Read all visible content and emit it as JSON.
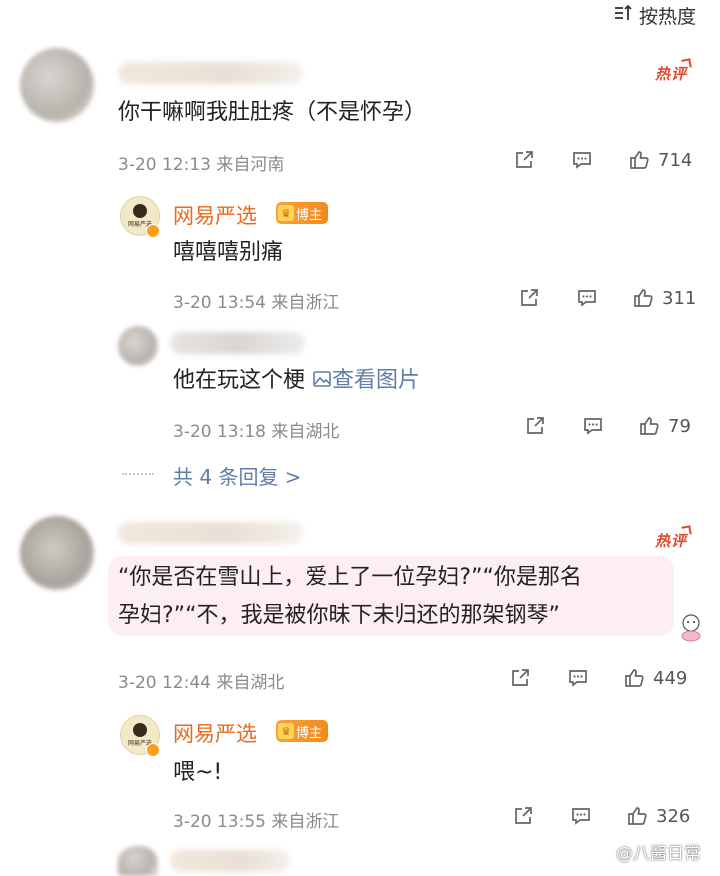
{
  "header": {
    "sort_label": "按热度"
  },
  "hot_label": "热评",
  "comments": [
    {
      "text": "你干嘛啊我肚肚疼（不是怀孕）",
      "date": "3-20 12:13",
      "location": "来自河南",
      "likes": "714"
    },
    {
      "text": "“你是否在雪山上，爱上了一位孕妇?”“你是那名",
      "text2": "孕妇?”“不，我是被你昧下未归还的那架钢琴”",
      "date": "3-20 12:44",
      "location": "来自湖北",
      "likes": "449"
    }
  ],
  "replies": [
    {
      "author": "网易严选",
      "badge": "博主",
      "avatar_caption": "网易严选",
      "text": "嘻嘻嘻别痛",
      "date": "3-20 13:54",
      "location": "来自浙江",
      "likes": "311"
    },
    {
      "text": "他在玩这个梗",
      "image_link": "查看图片",
      "date": "3-20 13:18",
      "location": "来自湖北",
      "likes": "79"
    },
    {
      "author": "网易严选",
      "badge": "博主",
      "avatar_caption": "网易严选",
      "text": "喂~!",
      "date": "3-20 13:55",
      "location": "来自浙江",
      "likes": "326"
    }
  ],
  "more_replies": "共 4 条回复 >",
  "watermark": "@八酱日常",
  "colors": {
    "brand": "#e86a1e",
    "hot": "#e24a2e",
    "link": "#5f7da8",
    "meta": "#8a8a8a",
    "highlight": "#fdeef3"
  },
  "icons": [
    "sort-icon",
    "share-icon",
    "comment-icon",
    "like-icon",
    "image-icon",
    "crown-icon",
    "weibo-icon",
    "sticker-icon"
  ]
}
